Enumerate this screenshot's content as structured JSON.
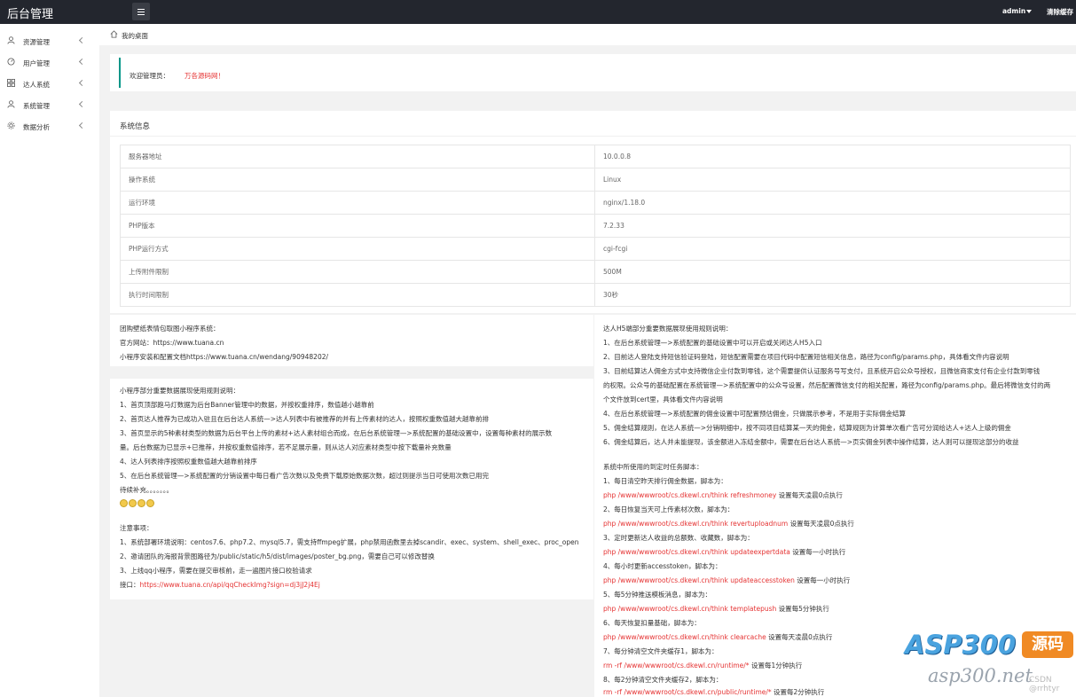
{
  "header": {
    "brand": "后台管理",
    "user": "admin",
    "clear_cache": "清除缓存"
  },
  "sidebar": {
    "items": [
      {
        "label": "资源管理",
        "icon": "user-icon"
      },
      {
        "label": "用户管理",
        "icon": "dashboard-icon"
      },
      {
        "label": "达人系统",
        "icon": "grid-icon"
      },
      {
        "label": "系统管理",
        "icon": "user-icon"
      },
      {
        "label": "数据分析",
        "icon": "gear-icon"
      }
    ]
  },
  "breadcrumb": {
    "current": "我的桌面"
  },
  "welcome": {
    "label": "欢迎管理员：",
    "name": "万各源码网！"
  },
  "sysinfo": {
    "title": "系统信息",
    "rows": [
      [
        "服务器地址",
        "10.0.0.8"
      ],
      [
        "操作系统",
        "Linux"
      ],
      [
        "运行环境",
        "nginx/1.18.0"
      ],
      [
        "PHP版本",
        "7.2.33"
      ],
      [
        "PHP运行方式",
        "cgi-fcgi"
      ],
      [
        "上传附件限制",
        "500M"
      ],
      [
        "执行时间限制",
        "30秒"
      ]
    ]
  },
  "left_panel": {
    "lines": [
      "团购壁纸表情包取图小程序系统：",
      "官方网站：https://www.tuana.cn",
      "小程序安装和配置文档https://www.tuana.cn/wendang/90948202/"
    ]
  },
  "rules_panel": {
    "lines": [
      "小程序部分重要数据展现使用规则说明：",
      "1、首页顶部跑马灯数据为后台Banner管理中的数据，并按权重排序，数值越小越靠前",
      "2、首页达人推荐为已成功入驻且在后台达人系统—>达人列表中有被推荐的并有上传素材的达人，按照权重数值越大越靠前排",
      "3、首页显示的5种素材类型的数据为后台平台上传的素材+达人素材组合而成，在后台系统管理—>系统配置的基础设置中，设置每种素材的展示数",
      "量。后台数据为已显示+已推荐，并按权重数值排序，若不足展示量，则从达人对应素材类型中按下载量补充数量",
      "4、达人列表排序按照权重数值越大越靠前排序",
      "5、在后台系统管理—>系统配置的分销设置中每日看广告次数以及免费下载原始数据次数，超过则提示当日可使用次数已用完",
      "待续补充。。。。。。。"
    ],
    "notes_title": "注意事项：",
    "notes": [
      "1、系统部署环境说明：centos7.6、php7.2、mysql5.7，需支持ffmpeg扩展，php禁用函数里去掉scandir、exec、system、shell_exec、proc_open",
      "2、邀请团队的海报背景图路径为/public/static/h5/dist/images/poster_bg.png，需要自己可以修改替换",
      "3、上线qq小程序，需要在提交审核前，走一遍图片接口校验请求"
    ],
    "api_label": "接口：",
    "api_url": "https://www.tuana.cn/api/qqCheckImg?sign=dj3jJ2j4Ej"
  },
  "right_panel": {
    "lines": [
      "达人H5端部分重要数据展现使用规则说明：",
      "1、在后台系统管理—>系统配置的基础设置中可以开启或关闭达人H5入口",
      "2、目前达人登陆支持短信验证码登陆，短信配置需要在项目代码中配置短信相关信息，路径为config/params.php，具体看文件内容说明",
      "3、目前结算达人佣金方式中支持微信企业付款到零钱，这个需要提供认证服务号写支付，且系统开启公众号授权，且微信商家支付有企业付款到零钱",
      "的权限。公众号的基础配置在系统管理—>系统配置中的公众号设置，然后配置微信支付的相关配置，路径为config/params.php。最后将微信支付的两",
      "个文件放到cert里，具体看文件内容说明",
      "4、在后台系统管理—>系统配置的佣金设置中可配置预估佣金，只做展示参考，不是用于实际佣金结算",
      "5、佣金结算规则，在达人系统—>分销明细中，按不同项目结算某一天的佣金，结算规则为计算单次看广告可分润给达人+达人上级的佣金",
      "6、佣金结算后，达人并未能提现，该金额进入冻结金额中，需要在后台达人系统—>页实佣金列表中操作结算，达人则可以提现这部分的收益"
    ],
    "cron_title": "系统中所使用的到定时任务脚本：",
    "cron": [
      {
        "t": "1、每日清空昨天排行佣金数据，脚本为：",
        "c": "php /www/wwwroot/cs.dkewl.cn/think refreshmoney",
        "s": " 设置每天凌晨0点执行"
      },
      {
        "t": "2、每日恢复当天可上传素材次数，脚本为：",
        "c": "php /www/wwwroot/cs.dkewl.cn/think revertuploadnum",
        "s": " 设置每天凌晨0点执行"
      },
      {
        "t": "3、定时更新达人收益的总额数、收藏数，脚本为：",
        "c": "php /www/wwwroot/cs.dkewl.cn/think updateexpertdata",
        "s": " 设置每一小时执行"
      },
      {
        "t": "4、每小时更新accesstoken，脚本为：",
        "c": "php /www/wwwroot/cs.dkewl.cn/think updateaccesstoken",
        "s": " 设置每一小时执行"
      },
      {
        "t": "5、每5分钟推送模板消息，脚本为：",
        "c": "php /www/wwwroot/cs.dkewl.cn/think templatepush",
        "s": " 设置每5分钟执行"
      },
      {
        "t": "6、每天恢复扣量基础，脚本为：",
        "c": "php /www/wwwroot/cs.dkewl.cn/think clearcache",
        "s": " 设置每天凌晨0点执行"
      },
      {
        "t": "7、每分钟清空文件夹缓存1，脚本为：",
        "c": "rm -rf /www/wwwroot/cs.dkewl.cn/runtime/*",
        "s": " 设置每1分钟执行"
      },
      {
        "t": "8、每2分钟清空文件夹缓存2，脚本为：",
        "c": "rm -rf /www/wwwroot/cs.dkewl.cn/public/runtime/*",
        "s": " 设置每2分钟执行"
      }
    ]
  },
  "watermark": {
    "brand": "ASP300",
    "badge": "源码",
    "domain": "asp300.net",
    "credit": "CSDN @rrhtyr"
  }
}
